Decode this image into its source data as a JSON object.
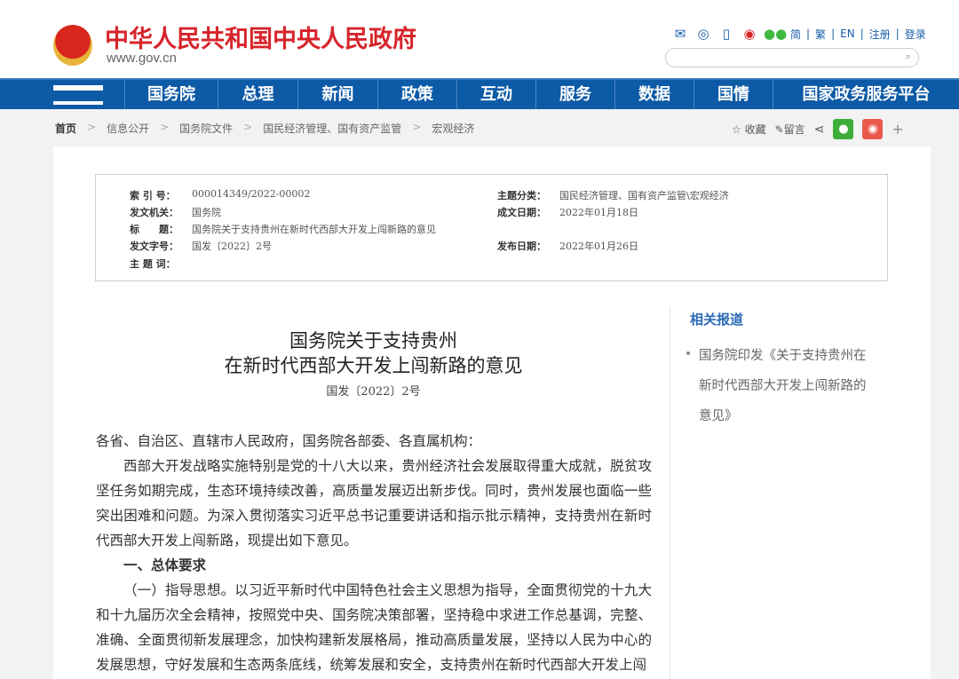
{
  "header": {
    "site_title": "中华人民共和国中央人民政府",
    "site_url": "www.gov.cn",
    "links": [
      "简",
      "繁",
      "EN",
      "注册",
      "登录"
    ],
    "search_placeholder": ""
  },
  "nav": [
    "国务院",
    "总理",
    "新闻",
    "政策",
    "互动",
    "服务",
    "数据",
    "国情",
    "国家政务服务平台"
  ],
  "breadcrumb": [
    "首页",
    "信息公开",
    "国务院文件",
    "国民经济管理、国有资产监管",
    "宏观经济"
  ],
  "tools": {
    "favorite": "收藏",
    "comment": "留言",
    "plus": "+"
  },
  "meta": {
    "index_label": "索 引 号：",
    "index": "000014349/2022-00002",
    "issuer_label": "发文机关：",
    "issuer": "国务院",
    "title_label": "标　　题：",
    "title": "国务院关于支持贵州在新时代西部大开发上闯新路的意见",
    "docno_label": "发文字号：",
    "docno": "国发〔2022〕2号",
    "keywords_label": "主 题 词：",
    "category_label": "主题分类：",
    "category": "国民经济管理、国有资产监管\\宏观经济",
    "created_label": "成文日期：",
    "created": "2022年01月18日",
    "published_label": "发布日期：",
    "published": "2022年01月26日"
  },
  "article": {
    "title_line1": "国务院关于支持贵州",
    "title_line2": "在新时代西部大开发上闯新路的意见",
    "docno": "国发〔2022〕2号",
    "salutation": "各省、自治区、直辖市人民政府，国务院各部委、各直属机构：",
    "para1": "西部大开发战略实施特别是党的十八大以来，贵州经济社会发展取得重大成就，脱贫攻坚任务如期完成，生态环境持续改善，高质量发展迈出新步伐。同时，贵州发展也面临一些突出困难和问题。为深入贯彻落实习近平总书记重要讲话和指示批示精神，支持贵州在新时代西部大开发上闯新路，现提出如下意见。",
    "heading1": "一、总体要求",
    "para2": "（一）指导思想。以习近平新时代中国特色社会主义思想为指导，全面贯彻党的十九大和十九届历次全会精神，按照党中央、国务院决策部署，坚持稳中求进工作总基调，完整、准确、全面贯彻新发展理念，加快构建新发展格局，推动高质量发展，坚持以人民为中心的发展思想，守好发展和生态两条底线，统筹发展和安全，支持贵州在新时代西部大开发上闯"
  },
  "sidebar": {
    "heading": "相关报道",
    "items": [
      "国务院印发《关于支持贵州在新时代西部大开发上闯新路的意见》"
    ]
  }
}
